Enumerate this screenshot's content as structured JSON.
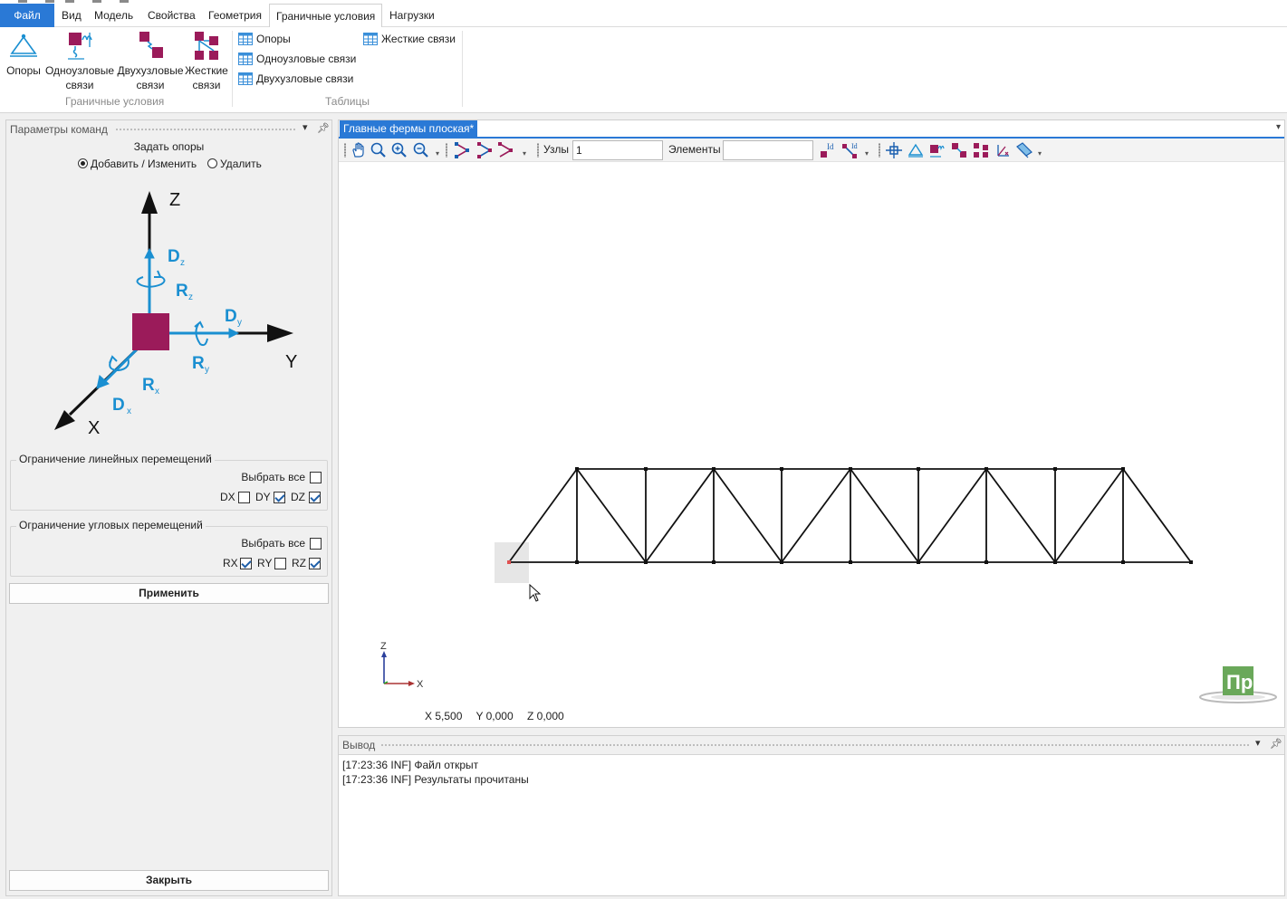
{
  "tabs": {
    "file": "Файл",
    "items": [
      "Вид",
      "Модель",
      "Свойства",
      "Геометрия",
      "Граничные условия",
      "Нагрузки"
    ],
    "active": "Граничные условия"
  },
  "ribbon": {
    "boundary_group": {
      "caption": "Граничные условия",
      "buttons": [
        {
          "line1": "Опоры",
          "line2": "",
          "icon": "support-triangle-icon"
        },
        {
          "line1": "Одноузловые",
          "line2": "связи",
          "icon": "single-node-link-icon"
        },
        {
          "line1": "Двухузловые",
          "line2": "связи",
          "icon": "two-node-link-icon"
        },
        {
          "line1": "Жесткие",
          "line2": "связи",
          "icon": "rigid-link-icon"
        }
      ]
    },
    "tables_group": {
      "caption": "Таблицы",
      "links": [
        "Опоры",
        "Одноузловые связи",
        "Двухузловые связи",
        "Жесткие связи"
      ]
    }
  },
  "left_panel": {
    "title": "Параметры команд",
    "heading": "Задать опоры",
    "radio_add": "Добавить / Изменить",
    "radio_delete": "Удалить",
    "radio_selected": "add",
    "diagram": {
      "axis_z": "Z",
      "axis_y": "Y",
      "axis_x": "X",
      "d_letter": "D",
      "r_letter": "R",
      "sub_z": "z",
      "sub_y": "y",
      "sub_x": "x",
      "node_color": "#9b1b5a",
      "arrow_color": "#1a8fd1"
    },
    "linear": {
      "title": "Ограничение линейных перемещений",
      "select_all": "Выбрать все",
      "select_all_checked": false,
      "items": [
        {
          "label": "DX",
          "checked": false
        },
        {
          "label": "DY",
          "checked": true
        },
        {
          "label": "DZ",
          "checked": true
        }
      ]
    },
    "angular": {
      "title": "Ограничение угловых перемещений",
      "select_all": "Выбрать все",
      "select_all_checked": false,
      "items": [
        {
          "label": "RX",
          "checked": true
        },
        {
          "label": "RY",
          "checked": false
        },
        {
          "label": "RZ",
          "checked": true
        }
      ]
    },
    "apply_button": "Применить",
    "close_button": "Закрыть"
  },
  "document": {
    "tab_title": "Главные фермы плоская*",
    "toolbar": {
      "nodes_label": "Узлы",
      "nodes_value": "1",
      "elements_label": "Элементы",
      "elements_value": ""
    },
    "axes": {
      "z": "Z",
      "x": "X"
    },
    "coords": {
      "x": "X 5,500",
      "y": "Y 0,000",
      "z": "Z 0,000"
    },
    "logo_text": "Пр",
    "logo_color": "#6aa85a"
  },
  "output": {
    "title": "Вывод",
    "lines": [
      "[17:23:36 INF] Файл открыт",
      "[17:23:36 INF] Результаты прочитаны"
    ]
  },
  "colors": {
    "accent": "#2a79d6",
    "brand_magenta": "#9b1b5a",
    "arrow_blue": "#1a8fd1",
    "table_icon_blue": "#3a8fd9"
  }
}
